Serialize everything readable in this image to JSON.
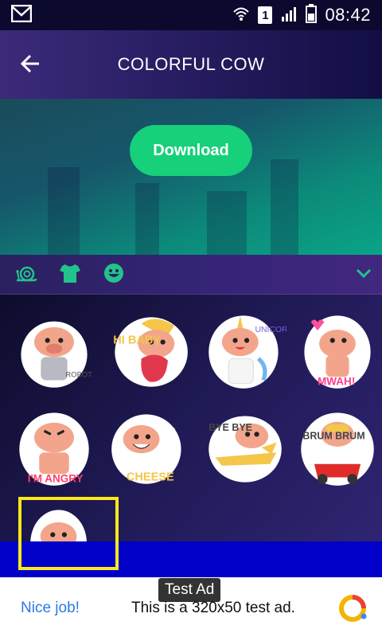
{
  "status_bar": {
    "time": "08:42",
    "sim_number": "1",
    "icons": [
      "gmail-icon",
      "wifi-icon",
      "signal-icon",
      "battery-icon"
    ]
  },
  "header": {
    "title": "COLORFUL COW",
    "back_icon": "arrow-left-icon"
  },
  "hero": {
    "download_label": "Download",
    "accent_color": "#17d07a"
  },
  "category_tabs": [
    {
      "icon": "snail-icon",
      "color": "#22c38a"
    },
    {
      "icon": "tshirt-icon",
      "color": "#22c38a"
    },
    {
      "icon": "smiley-icon",
      "color": "#22c38a"
    }
  ],
  "expand_icon": "chevron-down-icon",
  "stickers": [
    {
      "name": "sticker-robot",
      "caption": "ROBOT"
    },
    {
      "name": "sticker-hi-baby",
      "caption": "HI BABY"
    },
    {
      "name": "sticker-unicorn",
      "caption": "UNICORN"
    },
    {
      "name": "sticker-mwah",
      "caption": "MWAH!"
    },
    {
      "name": "sticker-angry",
      "caption": "I'M ANGRY"
    },
    {
      "name": "sticker-cheese",
      "caption": "CHEESE"
    },
    {
      "name": "sticker-bye-bye",
      "caption": "BYE BYE"
    },
    {
      "name": "sticker-brum-brum",
      "caption": "BRUM BRUM"
    },
    {
      "name": "sticker-cow-partial",
      "caption": ""
    }
  ],
  "ad": {
    "tag": "Test Ad",
    "cta": "Nice job!",
    "text": "This is a 320x50 test ad."
  }
}
